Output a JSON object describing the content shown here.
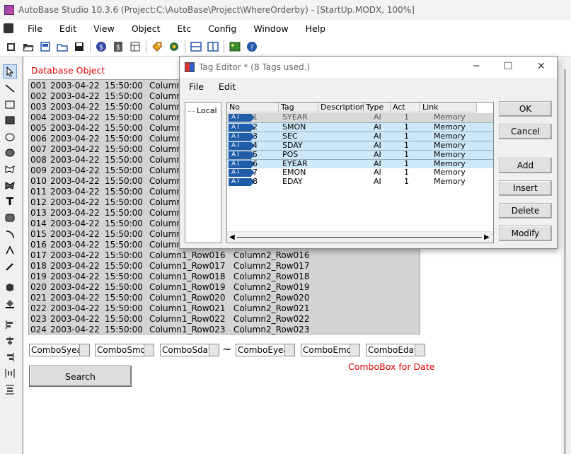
{
  "window": {
    "title": "AutoBase Studio 10.3.6 (Project:C:\\AutoBase\\Project\\WhereOrderby) - [StartUp.MODX, 100%]"
  },
  "menu": [
    "File",
    "Edit",
    "View",
    "Object",
    "Etc",
    "Config",
    "Window",
    "Help"
  ],
  "toolbar": {
    "icons": [
      "new-icon",
      "open-folder-icon",
      "save-as-icon",
      "open-icon",
      "save-icon",
      "dollar-icon",
      "dollar-doc-icon",
      "table-icon",
      "tag-icon",
      "gear-icon",
      "split-horizontal-icon",
      "split-vertical-icon",
      "image-icon",
      "help-icon"
    ]
  },
  "palette": {
    "tools": [
      "pointer-icon",
      "line-icon",
      "rectangle-icon",
      "filled-rectangle-icon",
      "ellipse-icon",
      "filled-ellipse-icon",
      "polygon-icon",
      "filled-polygon-icon",
      "text-icon",
      "rounded-rect-icon",
      "arc-icon",
      "node-edit-icon",
      "dropper-icon",
      "cube-icon",
      "fill-icon",
      "align-left-icon",
      "align-center-icon",
      "align-right-icon",
      "distribute-h-icon",
      "distribute-v-icon"
    ],
    "text_tool_label": "T"
  },
  "canvas": {
    "db_object_label": "Database Object",
    "rows": [
      {
        "no": "001",
        "date": "2003-04-22",
        "time": "15:50:00",
        "c1": "Column",
        "c2": ""
      },
      {
        "no": "002",
        "date": "2003-04-22",
        "time": "15:50:00",
        "c1": "Column",
        "c2": ""
      },
      {
        "no": "003",
        "date": "2003-04-22",
        "time": "15:50:00",
        "c1": "Column",
        "c2": ""
      },
      {
        "no": "004",
        "date": "2003-04-22",
        "time": "15:50:00",
        "c1": "Column",
        "c2": ""
      },
      {
        "no": "005",
        "date": "2003-04-22",
        "time": "15:50:00",
        "c1": "Column",
        "c2": ""
      },
      {
        "no": "006",
        "date": "2003-04-22",
        "time": "15:50:00",
        "c1": "Column",
        "c2": ""
      },
      {
        "no": "007",
        "date": "2003-04-22",
        "time": "15:50:00",
        "c1": "Column",
        "c2": ""
      },
      {
        "no": "008",
        "date": "2003-04-22",
        "time": "15:50:00",
        "c1": "Column",
        "c2": ""
      },
      {
        "no": "009",
        "date": "2003-04-22",
        "time": "15:50:00",
        "c1": "Column",
        "c2": ""
      },
      {
        "no": "010",
        "date": "2003-04-22",
        "time": "15:50:00",
        "c1": "Column",
        "c2": ""
      },
      {
        "no": "011",
        "date": "2003-04-22",
        "time": "15:50:00",
        "c1": "Column",
        "c2": ""
      },
      {
        "no": "012",
        "date": "2003-04-22",
        "time": "15:50:00",
        "c1": "Column",
        "c2": ""
      },
      {
        "no": "013",
        "date": "2003-04-22",
        "time": "15:50:00",
        "c1": "Column",
        "c2": ""
      },
      {
        "no": "014",
        "date": "2003-04-22",
        "time": "15:50:00",
        "c1": "Column",
        "c2": ""
      },
      {
        "no": "015",
        "date": "2003-04-22",
        "time": "15:50:00",
        "c1": "Column",
        "c2": ""
      },
      {
        "no": "016",
        "date": "2003-04-22",
        "time": "15:50:00",
        "c1": "Column",
        "c2": ""
      },
      {
        "no": "017",
        "date": "2003-04-22",
        "time": "15:50:00",
        "c1": "Column1_Row016",
        "c2": "Column2_Row016"
      },
      {
        "no": "018",
        "date": "2003-04-22",
        "time": "15:50:00",
        "c1": "Column1_Row017",
        "c2": "Column2_Row017"
      },
      {
        "no": "019",
        "date": "2003-04-22",
        "time": "15:50:00",
        "c1": "Column1_Row018",
        "c2": "Column2_Row018"
      },
      {
        "no": "020",
        "date": "2003-04-22",
        "time": "15:50:00",
        "c1": "Column1_Row019",
        "c2": "Column2_Row019"
      },
      {
        "no": "021",
        "date": "2003-04-22",
        "time": "15:50:00",
        "c1": "Column1_Row020",
        "c2": "Column2_Row020"
      },
      {
        "no": "022",
        "date": "2003-04-22",
        "time": "15:50:00",
        "c1": "Column1_Row021",
        "c2": "Column2_Row021"
      },
      {
        "no": "023",
        "date": "2003-04-22",
        "time": "15:50:00",
        "c1": "Column1_Row022",
        "c2": "Column2_Row022"
      },
      {
        "no": "024",
        "date": "2003-04-22",
        "time": "15:50:00",
        "c1": "Column1_Row023",
        "c2": "Column2_Row023"
      }
    ],
    "combos": [
      "ComboSyea",
      "ComboSmo",
      "ComboSday",
      "ComboEyea",
      "ComboEmo",
      "ComboEday"
    ],
    "tilde": "~",
    "combo_note": "ComboBox for Date",
    "search_label": "Search"
  },
  "tag_editor": {
    "title": "Tag Editor * (8 Tags used.)",
    "menu": [
      "File",
      "Edit"
    ],
    "tree_node": "Local",
    "columns": [
      "No",
      "Tag",
      "Description",
      "Type",
      "Act",
      "Link"
    ],
    "rows": [
      {
        "badge": "AI",
        "no": "1",
        "tag": "SYEAR",
        "desc": "",
        "type": "AI",
        "act": "1",
        "link": "Memory"
      },
      {
        "badge": "AI",
        "no": "2",
        "tag": "SMON",
        "desc": "",
        "type": "AI",
        "act": "1",
        "link": "Memory"
      },
      {
        "badge": "AI",
        "no": "3",
        "tag": "SEC",
        "desc": "",
        "type": "AI",
        "act": "1",
        "link": "Memory"
      },
      {
        "badge": "AI",
        "no": "4",
        "tag": "SDAY",
        "desc": "",
        "type": "AI",
        "act": "1",
        "link": "Memory"
      },
      {
        "badge": "AI",
        "no": "5",
        "tag": "POS",
        "desc": "",
        "type": "AI",
        "act": "1",
        "link": "Memory"
      },
      {
        "badge": "AI",
        "no": "6",
        "tag": "EYEAR",
        "desc": "",
        "type": "AI",
        "act": "1",
        "link": "Memory"
      },
      {
        "badge": "AI",
        "no": "7",
        "tag": "EMON",
        "desc": "",
        "type": "AI",
        "act": "1",
        "link": "Memory"
      },
      {
        "badge": "AI",
        "no": "8",
        "tag": "EDAY",
        "desc": "",
        "type": "AI",
        "act": "1",
        "link": "Memory"
      }
    ],
    "buttons": {
      "ok": "OK",
      "cancel": "Cancel",
      "add": "Add",
      "insert": "Insert",
      "delete": "Delete",
      "modify": "Modify"
    },
    "window_buttons": {
      "minimize": "─",
      "maximize": "☐",
      "close": "✕"
    }
  },
  "colors": {
    "accent_red": "#e00000",
    "badge_blue": "#1f5da8",
    "selection": "#cde8f7"
  }
}
